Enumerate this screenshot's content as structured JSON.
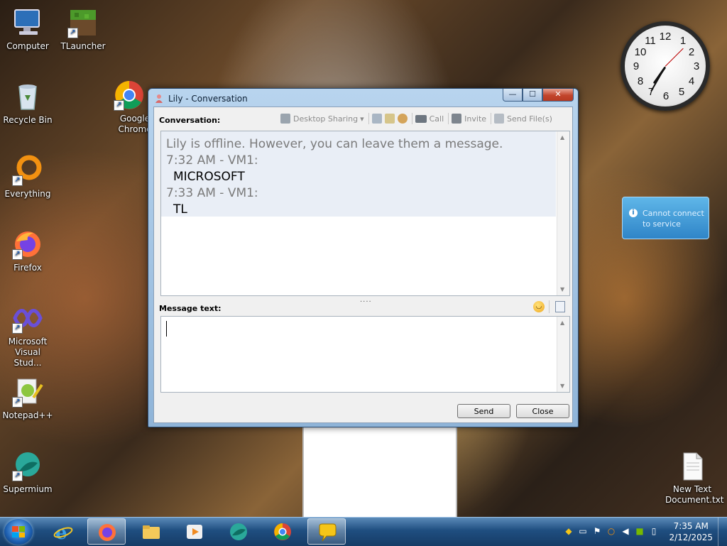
{
  "desktop": {
    "icons": [
      {
        "label": "Computer"
      },
      {
        "label": "TLauncher"
      },
      {
        "label": "Recycle Bin"
      },
      {
        "label": "Google Chrome"
      },
      {
        "label": "Everything"
      },
      {
        "label": "Firefox"
      },
      {
        "label": "Microsoft Visual Stud..."
      },
      {
        "label": "Notepad++"
      },
      {
        "label": "Supermium"
      },
      {
        "label": "New Text Document.txt"
      }
    ],
    "notification": {
      "text": "Cannot connect to service"
    },
    "clock_numbers": [
      "12",
      "1",
      "2",
      "3",
      "4",
      "5",
      "6",
      "7",
      "8",
      "9",
      "10",
      "11"
    ]
  },
  "window": {
    "title": "Lily - Conversation",
    "min_glyph": "—",
    "max_glyph": "☐",
    "close_glyph": "✕",
    "conversation_label": "Conversation:",
    "toolbar": {
      "desktop_sharing": "Desktop Sharing",
      "call": "Call",
      "invite": "Invite",
      "send_files": "Send File(s)"
    },
    "conversation": {
      "offline_notice": "Lily is offline. However, you can leave them a message.",
      "messages": [
        {
          "header": "7:32 AM - VM1:",
          "text": "MICROSOFT"
        },
        {
          "header": "7:33 AM - VM1:",
          "text": "TL"
        }
      ]
    },
    "splitter": "....",
    "message_label": "Message text:",
    "message_value": "",
    "send_label": "Send",
    "close_label": "Close"
  },
  "taskbar": {
    "time": "7:35 AM",
    "date": "2/12/2025"
  },
  "colors": {
    "window_frame": "#b8d4ee",
    "taskbar": "#1f4e80",
    "notification": "#3a95d4"
  }
}
